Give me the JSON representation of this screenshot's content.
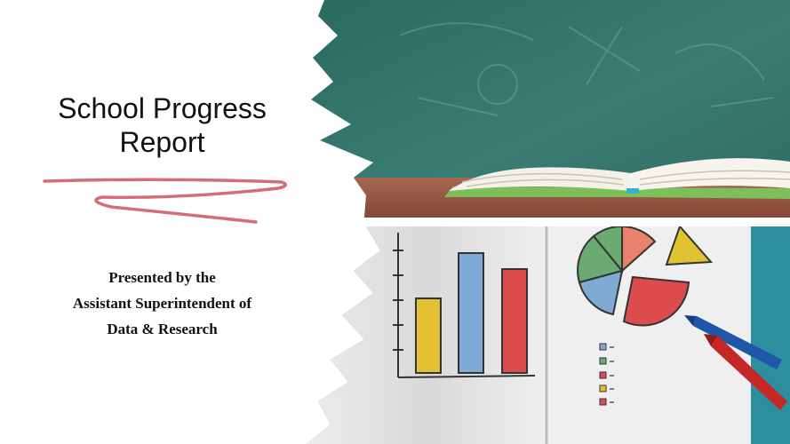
{
  "slide": {
    "title_line1": "School Progress",
    "title_line2": "Report",
    "subtitle_line1": "Presented by the",
    "subtitle_line2": "Assistant Superintendent of",
    "subtitle_line3": "Data & Research"
  },
  "colors": {
    "chalkboard": "#2f6a60",
    "desk": "#9b5a47",
    "squiggle": "#d46d76",
    "bar_yellow": "#e2c232",
    "bar_blue": "#7faad4",
    "bar_red": "#dc4c4c",
    "pie_green": "#6aab72",
    "crayon_blue": "#1f56a8",
    "crayon_red": "#c62828",
    "teal_surface": "#2b8fa0"
  }
}
